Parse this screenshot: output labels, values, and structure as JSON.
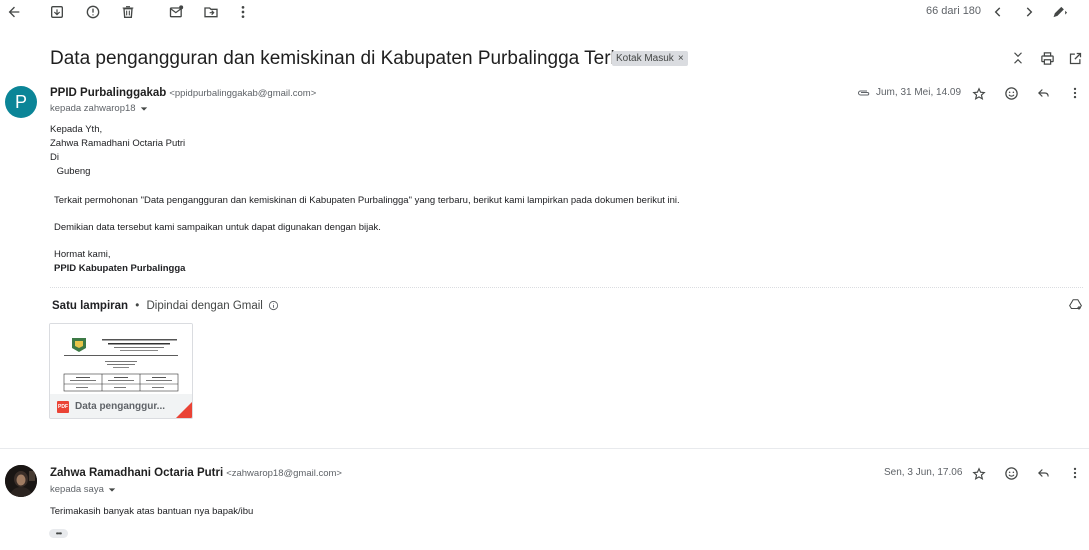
{
  "toolbar": {
    "back_icon": "arrow-back-icon",
    "archive_icon": "archive-icon",
    "spam_icon": "report-spam-icon",
    "delete_icon": "trash-icon",
    "mark_unread_icon": "mark-unread-icon",
    "move_icon": "move-to-folder-icon",
    "more_icon": "more-vert-icon",
    "count": "66 dari 180",
    "prev_icon": "chevron-left-icon",
    "next_icon": "chevron-right-icon",
    "pen_icon": "edit-pen-icon"
  },
  "thread": {
    "subject": "Data pengangguran dan kemiskinan di Kabupaten Purbalingga Terbaru",
    "label": "Kotak Masuk",
    "label_close": "×"
  },
  "message1": {
    "avatar_letter": "P",
    "avatar_color": "#0b8597",
    "sender_name": "PPID Purbalinggakab",
    "sender_email": "<ppidpurbalinggakab@gmail.com>",
    "to": "kepada zahwarop18",
    "date": "Jum, 31 Mei, 14.09",
    "body": {
      "l1": "Kepada Yth,",
      "l2": "Zahwa Ramadhani Octaria Putri",
      "l3": "Di",
      "l4": " Gubeng",
      "p1": "Terkait permohonan \"Data pengangguran dan kemiskinan di Kabupaten Purbalingga\" yang terbaru, berikut kami lampirkan pada dokumen berikut ini.",
      "p2": "Demikian data tersebut kami sampaikan untuk dapat digunakan dengan bijak.",
      "closing": "Hormat kami,",
      "signature": "PPID Kabupaten Purbalingga"
    },
    "attachments": {
      "heading": "Satu lampiran",
      "separator": "•",
      "scanned": "Dipindai dengan Gmail",
      "file_name": "Data penganggur...",
      "file_type": "PDF"
    }
  },
  "message2": {
    "sender_name": "Zahwa Ramadhani Octaria Putri",
    "sender_email": "<zahwarop18@gmail.com>",
    "to": "kepada saya",
    "date": "Sen, 3 Jun, 17.06",
    "body": "Terimakasih banyak atas bantuan nya bapak/ibu",
    "more": "•••"
  }
}
